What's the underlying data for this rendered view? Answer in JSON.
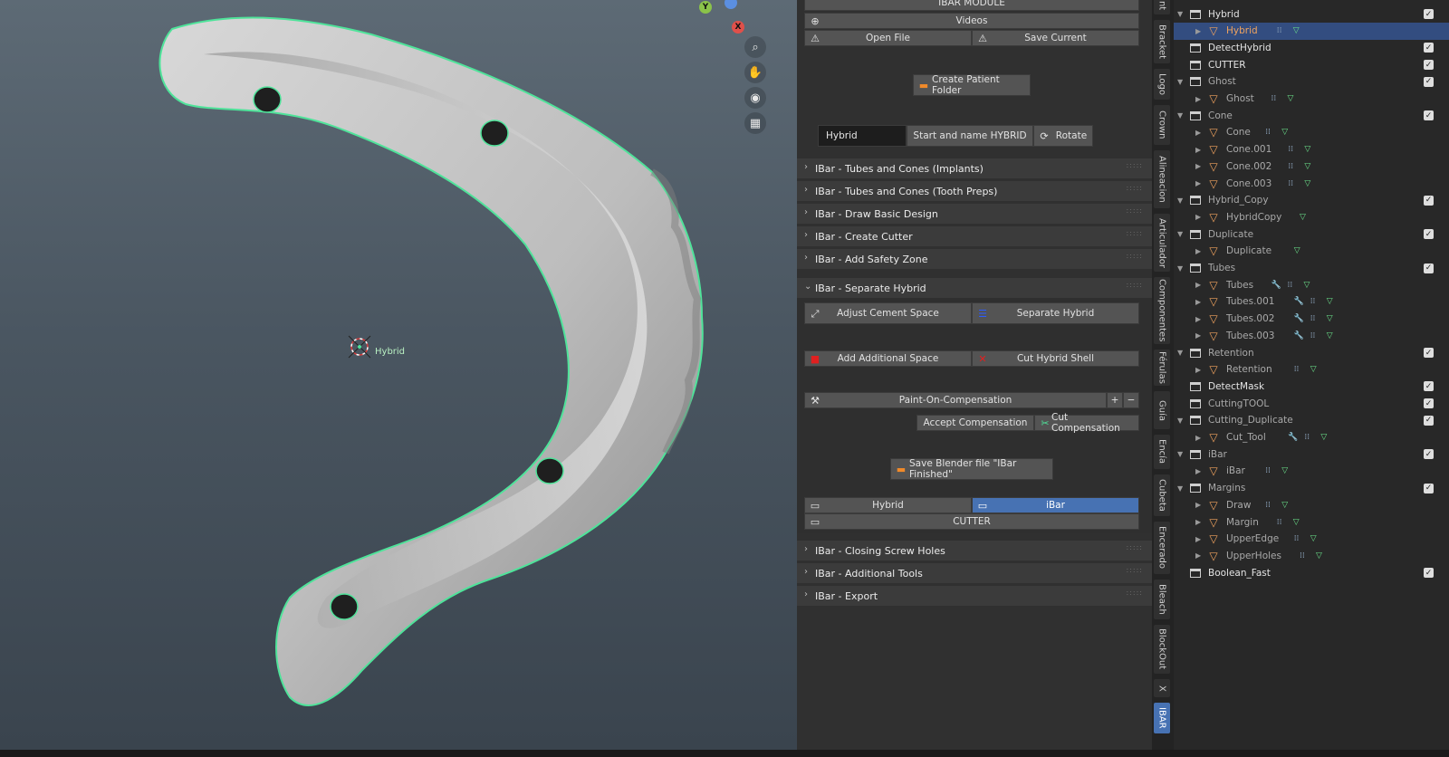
{
  "panel": {
    "header": "IBAR MODULE",
    "top_buttons": {
      "videos": "Videos",
      "open_file": "Open File",
      "save_current": "Save Current"
    },
    "create_patient_folder": "Create Patient Folder",
    "name_field": "Hybrid",
    "start_name": "Start and name HYBRID",
    "rotate": "Rotate",
    "sections_top": [
      "IBar - Tubes and Cones (Implants)",
      "IBar - Tubes and Cones (Tooth Preps)",
      "IBar - Draw Basic Design",
      "IBar - Create Cutter",
      "IBar - Add Safety Zone"
    ],
    "open_section": "IBar - Separate Hybrid",
    "adjust_cement": "Adjust Cement Space",
    "separate_hybrid": "Separate Hybrid",
    "add_space": "Add Additional Space",
    "cut_shell": "Cut Hybrid Shell",
    "paint_comp": "Paint-On-Compensation",
    "plus": "+",
    "minus": "−",
    "accept_comp": "Accept Compensation",
    "cut_comp": "Cut Compensation",
    "save_finished": "Save Blender file \"IBar Finished\"",
    "view_hybrid": "Hybrid",
    "view_ibar": "iBar",
    "view_cutter": "CUTTER",
    "sections_bottom": [
      "IBar - Closing Screw Holes",
      "IBar - Additional Tools",
      "IBar - Export"
    ]
  },
  "tabs": [
    "Int",
    "Bracket",
    "Logo",
    "Crown",
    "Alineacion",
    "Articulador",
    "Componentes",
    "Férulas",
    "Guía",
    "Encía",
    "Cubeta",
    "Encerado",
    "Bleach",
    "BlockOut",
    "X",
    "IBAR"
  ],
  "viewport": {
    "object_label": "Hybrid",
    "gizmo": {
      "y": "Y",
      "x": "X",
      "z": "Z"
    },
    "icons": [
      "zoom-icon",
      "hand-icon",
      "camera-icon",
      "grid-icon"
    ]
  },
  "outliner": [
    {
      "name": "Hybrid",
      "type": "collection",
      "depth": 1,
      "expanded": true,
      "check": true,
      "dim": false
    },
    {
      "name": "Hybrid",
      "type": "mesh",
      "depth": 2,
      "selected": true,
      "mods": [
        "modifier-icon",
        "mesh-data-icon"
      ]
    },
    {
      "name": "DetectHybrid",
      "type": "collection",
      "depth": 1,
      "check": true,
      "dim": false
    },
    {
      "name": "CUTTER",
      "type": "collection",
      "depth": 1,
      "check": true,
      "dim": false
    },
    {
      "name": "Ghost",
      "type": "collection",
      "depth": 1,
      "expanded": true,
      "check": true,
      "dim": true
    },
    {
      "name": "Ghost",
      "type": "mesh",
      "depth": 2,
      "dim": true,
      "mods": [
        "modifier-icon",
        "mesh-data-icon"
      ]
    },
    {
      "name": "Cone",
      "type": "collection",
      "depth": 1,
      "expanded": true,
      "check": true,
      "dim": true
    },
    {
      "name": "Cone",
      "type": "mesh",
      "depth": 2,
      "dim": true,
      "mods": [
        "modifier-icon",
        "mesh-data-icon"
      ]
    },
    {
      "name": "Cone.001",
      "type": "mesh",
      "depth": 2,
      "dim": true,
      "mods": [
        "modifier-icon",
        "mesh-data-icon"
      ]
    },
    {
      "name": "Cone.002",
      "type": "mesh",
      "depth": 2,
      "dim": true,
      "mods": [
        "modifier-icon",
        "mesh-data-icon"
      ]
    },
    {
      "name": "Cone.003",
      "type": "mesh",
      "depth": 2,
      "dim": true,
      "mods": [
        "modifier-icon",
        "mesh-data-icon"
      ]
    },
    {
      "name": "Hybrid_Copy",
      "type": "collection",
      "depth": 1,
      "expanded": true,
      "check": true,
      "dim": true
    },
    {
      "name": "HybridCopy",
      "type": "mesh",
      "depth": 2,
      "dim": true,
      "mods": [
        "mesh-data-icon"
      ]
    },
    {
      "name": "Duplicate",
      "type": "collection",
      "depth": 1,
      "expanded": true,
      "check": true,
      "dim": true
    },
    {
      "name": "Duplicate",
      "type": "mesh",
      "depth": 2,
      "dim": true,
      "mods": [
        "mesh-data-icon"
      ]
    },
    {
      "name": "Tubes",
      "type": "collection",
      "depth": 1,
      "expanded": true,
      "check": true,
      "dim": true
    },
    {
      "name": "Tubes",
      "type": "mesh",
      "depth": 2,
      "dim": true,
      "mods": [
        "wrench-icon",
        "modifier-icon",
        "mesh-data-icon"
      ]
    },
    {
      "name": "Tubes.001",
      "type": "mesh",
      "depth": 2,
      "dim": true,
      "mods": [
        "wrench-icon",
        "modifier-icon",
        "mesh-data-icon"
      ]
    },
    {
      "name": "Tubes.002",
      "type": "mesh",
      "depth": 2,
      "dim": true,
      "mods": [
        "wrench-icon",
        "modifier-icon",
        "mesh-data-icon"
      ]
    },
    {
      "name": "Tubes.003",
      "type": "mesh",
      "depth": 2,
      "dim": true,
      "mods": [
        "wrench-icon",
        "modifier-icon",
        "mesh-data-icon"
      ]
    },
    {
      "name": "Retention",
      "type": "collection",
      "depth": 1,
      "expanded": true,
      "check": true,
      "dim": true
    },
    {
      "name": "Retention",
      "type": "mesh",
      "depth": 2,
      "dim": true,
      "mods": [
        "modifier-icon",
        "mesh-data-icon"
      ]
    },
    {
      "name": "DetectMask",
      "type": "collection",
      "depth": 1,
      "check": true,
      "dim": false
    },
    {
      "name": "CuttingTOOL",
      "type": "collection",
      "depth": 1,
      "check": true,
      "dim": true
    },
    {
      "name": "Cutting_Duplicate",
      "type": "collection",
      "depth": 1,
      "expanded": true,
      "check": true,
      "dim": true
    },
    {
      "name": "Cut_Tool",
      "type": "mesh",
      "depth": 2,
      "dim": true,
      "mods": [
        "wrench-icon",
        "modifier-icon",
        "mesh-data-icon"
      ]
    },
    {
      "name": "iBar",
      "type": "collection",
      "depth": 1,
      "expanded": true,
      "check": true,
      "dim": true
    },
    {
      "name": "iBar",
      "type": "mesh",
      "depth": 2,
      "dim": true,
      "mods": [
        "modifier-icon",
        "mesh-data-icon"
      ]
    },
    {
      "name": "Margins",
      "type": "collection",
      "depth": 1,
      "expanded": true,
      "check": true,
      "dim": true
    },
    {
      "name": "Draw",
      "type": "mesh",
      "depth": 2,
      "dim": true,
      "mods": [
        "modifier-icon",
        "mesh-data-icon"
      ]
    },
    {
      "name": "Margin",
      "type": "mesh",
      "depth": 2,
      "dim": true,
      "mods": [
        "modifier-icon",
        "mesh-data-icon"
      ]
    },
    {
      "name": "UpperEdge",
      "type": "mesh",
      "depth": 2,
      "dim": true,
      "mods": [
        "modifier-icon",
        "mesh-data-icon"
      ]
    },
    {
      "name": "UpperHoles",
      "type": "mesh",
      "depth": 2,
      "dim": true,
      "mods": [
        "modifier-icon",
        "mesh-data-icon"
      ]
    },
    {
      "name": "Boolean_Fast",
      "type": "collection",
      "depth": 1,
      "check": true,
      "dim": false
    }
  ],
  "colors": {
    "accent": "#4772b3",
    "outline": "#4fe39a",
    "mesh_icon": "#f0a35e"
  }
}
